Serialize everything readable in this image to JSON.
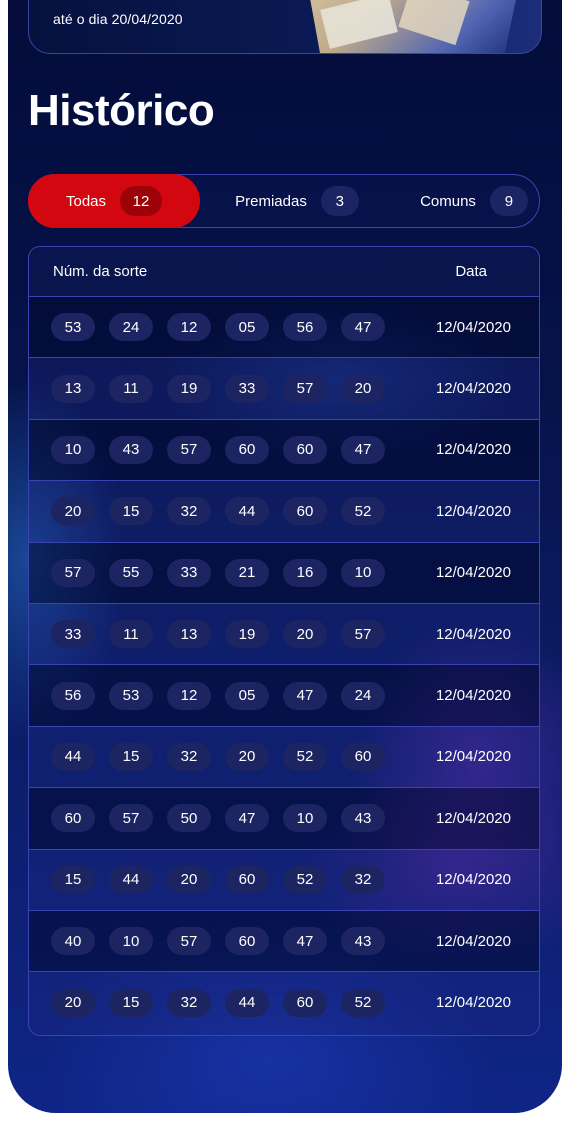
{
  "banner": {
    "text": "até o dia 20/04/2020"
  },
  "page": {
    "title": "Histórico"
  },
  "tabs": [
    {
      "label": "Todas",
      "count": "12",
      "active": true
    },
    {
      "label": "Premiadas",
      "count": "3",
      "active": false
    },
    {
      "label": "Comuns",
      "count": "9",
      "active": false
    }
  ],
  "table": {
    "headers": {
      "numbers": "Núm. da sorte",
      "date": "Data"
    },
    "rows": [
      {
        "numbers": [
          "53",
          "24",
          "12",
          "05",
          "56",
          "47"
        ],
        "date": "12/04/2020"
      },
      {
        "numbers": [
          "13",
          "11",
          "19",
          "33",
          "57",
          "20"
        ],
        "date": "12/04/2020"
      },
      {
        "numbers": [
          "10",
          "43",
          "57",
          "60",
          "60",
          "47"
        ],
        "date": "12/04/2020"
      },
      {
        "numbers": [
          "20",
          "15",
          "32",
          "44",
          "60",
          "52"
        ],
        "date": "12/04/2020"
      },
      {
        "numbers": [
          "57",
          "55",
          "33",
          "21",
          "16",
          "10"
        ],
        "date": "12/04/2020"
      },
      {
        "numbers": [
          "33",
          "11",
          "13",
          "19",
          "20",
          "57"
        ],
        "date": "12/04/2020"
      },
      {
        "numbers": [
          "56",
          "53",
          "12",
          "05",
          "47",
          "24"
        ],
        "date": "12/04/2020"
      },
      {
        "numbers": [
          "44",
          "15",
          "32",
          "20",
          "52",
          "60"
        ],
        "date": "12/04/2020"
      },
      {
        "numbers": [
          "60",
          "57",
          "50",
          "47",
          "10",
          "43"
        ],
        "date": "12/04/2020"
      },
      {
        "numbers": [
          "15",
          "44",
          "20",
          "60",
          "52",
          "32"
        ],
        "date": "12/04/2020"
      },
      {
        "numbers": [
          "40",
          "10",
          "57",
          "60",
          "47",
          "43"
        ],
        "date": "12/04/2020"
      },
      {
        "numbers": [
          "20",
          "15",
          "32",
          "44",
          "60",
          "52"
        ],
        "date": "12/04/2020"
      }
    ]
  },
  "colors": {
    "accent": "#d3070f",
    "background": "#06134a",
    "border": "#3a43b2",
    "chip": "#1c2461"
  }
}
